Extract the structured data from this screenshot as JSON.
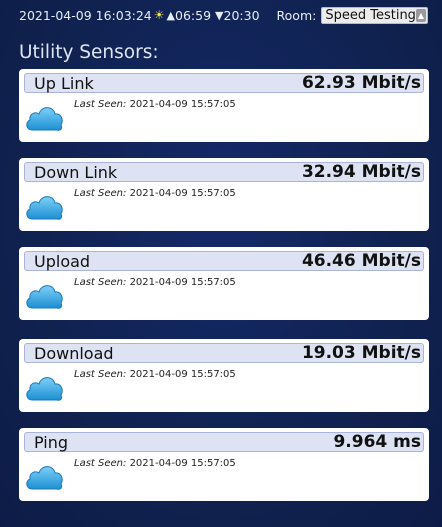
{
  "topbar": {
    "datetime": "2021-04-09 16:03:24",
    "sun_icon": "sun-icon",
    "sunrise_arrow": "▲",
    "sunrise": "06:59",
    "sunset_arrow": "▼",
    "sunset": "20:30",
    "room_label": "Room:",
    "room_value": "Speed Testing"
  },
  "section_title": "Utility Sensors:",
  "colors": {
    "background": "#112255",
    "header_bg": "#dde3f3",
    "cloud_blue": "#1e9ad9"
  },
  "sensors": [
    {
      "name": "Up Link",
      "value": "62.93 Mbit/s",
      "seen_label": "Last Seen:",
      "seen": "2021-04-09 15:57:05",
      "icon": "cloud-icon"
    },
    {
      "name": "Down Link",
      "value": "32.94 Mbit/s",
      "seen_label": "Last Seen:",
      "seen": "2021-04-09 15:57:05",
      "icon": "cloud-icon"
    },
    {
      "name": "Upload",
      "value": "46.46 Mbit/s",
      "seen_label": "Last Seen:",
      "seen": "2021-04-09 15:57:05",
      "icon": "cloud-icon"
    },
    {
      "name": "Download",
      "value": "19.03 Mbit/s",
      "seen_label": "Last Seen:",
      "seen": "2021-04-09 15:57:05",
      "icon": "cloud-icon"
    },
    {
      "name": "Ping",
      "value": "9.964 ms",
      "seen_label": "Last Seen:",
      "seen": "2021-04-09 15:57:05",
      "icon": "cloud-icon"
    }
  ]
}
